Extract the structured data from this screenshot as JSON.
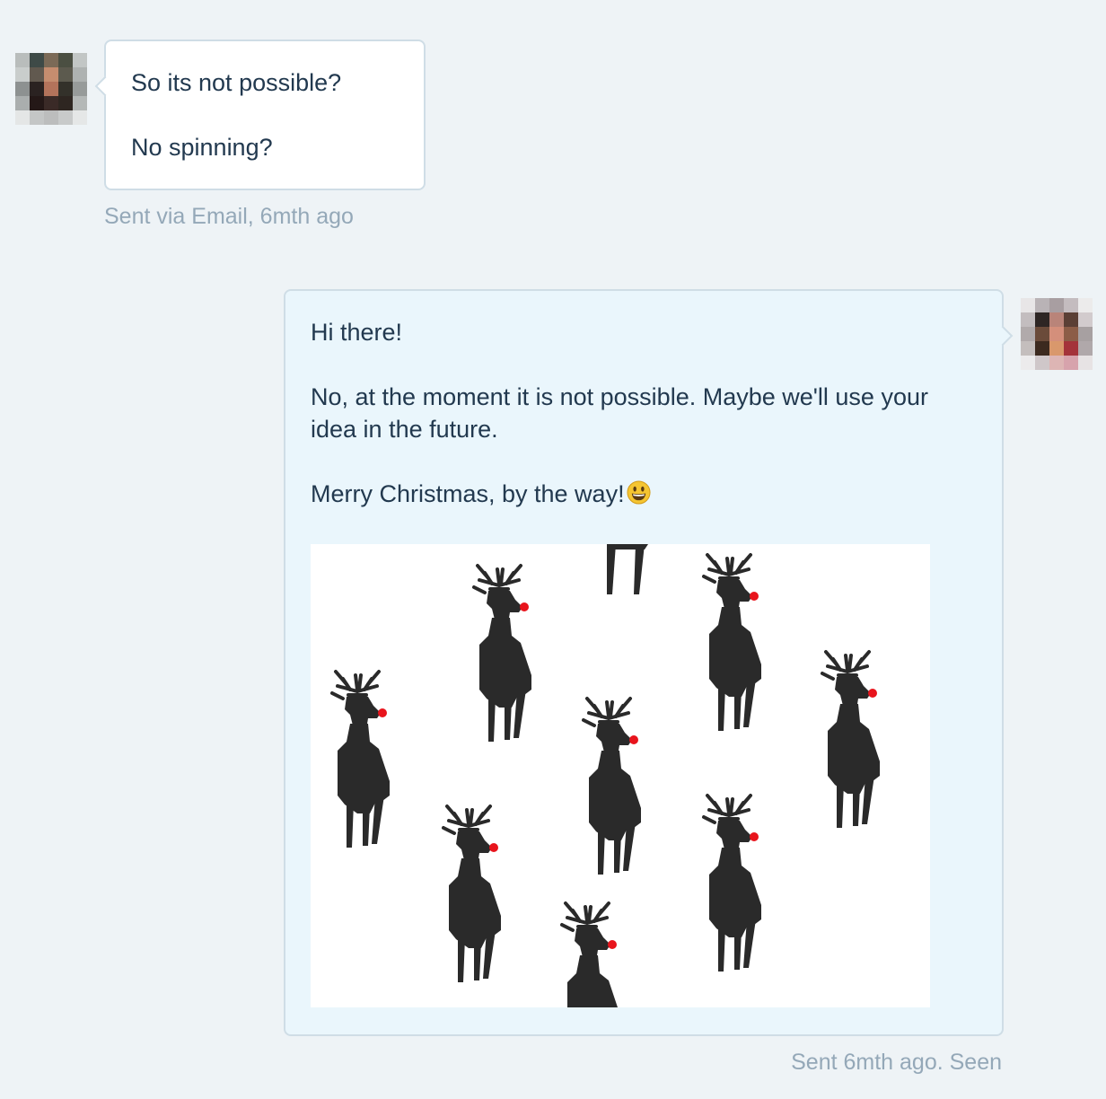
{
  "conversation": {
    "incoming": {
      "lines": [
        "So its not possible?",
        "No spinning?"
      ],
      "meta": "Sent via Email, 6mth ago"
    },
    "outgoing": {
      "greeting": "Hi there!",
      "body": "No, at the moment it is not possible. Maybe we'll use your idea in the future.",
      "closing": "Merry Christmas, by the way!",
      "emoji": "smiling-face-emoji",
      "attachment": "reindeer-pattern-image",
      "meta": "Sent 6mth ago. Seen"
    }
  },
  "colors": {
    "page_background": "#eef3f6",
    "incoming_bubble": "#ffffff",
    "outgoing_bubble": "#eaf6fc",
    "bubble_border": "#cfdde6",
    "text": "#22394f",
    "meta_text": "#94a8b8",
    "reindeer": "#2a2a2a",
    "reindeer_nose": "#e8141c"
  }
}
